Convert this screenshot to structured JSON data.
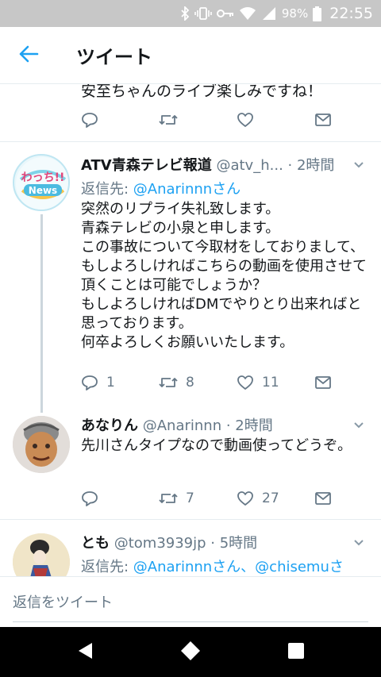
{
  "status_bar": {
    "battery": "98%",
    "time": "22:55",
    "icons": [
      "bluetooth-icon",
      "vibrate-icon",
      "key-icon",
      "wifi-icon",
      "signal-icon",
      "battery-icon"
    ]
  },
  "app_bar": {
    "title": "ツイート",
    "back_icon": "arrow-left-icon"
  },
  "colors": {
    "accent": "#1da1f2",
    "muted": "#657786",
    "text": "#14171a",
    "divider": "#e6ecf0"
  },
  "previous_tweet": {
    "text_partial": "安至ちゃんのライブ楽しみですね！"
  },
  "tweets": [
    {
      "name": "ATV青森テレビ報道",
      "meta": " @atv_h... · 2時間",
      "reply_label": "返信先: ",
      "reply_mentions": "@Anarinnnさん",
      "text": "突然のリプライ失礼致します。\n青森テレビの小泉と申します。\nこの事故について今取材をしておりまして、もしよろしければこちらの動画を使用させて頂くことは可能でしょうか？\nもしよろしければDMでやりとり出来ればと思っております。\n何卒よろしくお願いいたします。",
      "avatar_text_1": "わっち!!",
      "avatar_text_2": "News",
      "replies": "1",
      "retweets": "8",
      "likes": "11"
    },
    {
      "name": "あなりん",
      "meta": " @Anarinnn · 2時間",
      "text": "先川さんタイプなので動画使ってどうぞ。",
      "replies": "",
      "retweets": "7",
      "likes": "27"
    },
    {
      "name": "とも",
      "meta": " @tom3939jp · 5時間",
      "reply_label": "返信先: ",
      "reply_mentions": "@Anarinnnさん、@chisemuさ"
    }
  ],
  "compose": {
    "placeholder": "返信をツイート"
  },
  "nav_bar": {
    "buttons": [
      "back-triangle-icon",
      "home-circle-icon",
      "recents-square-icon"
    ]
  }
}
